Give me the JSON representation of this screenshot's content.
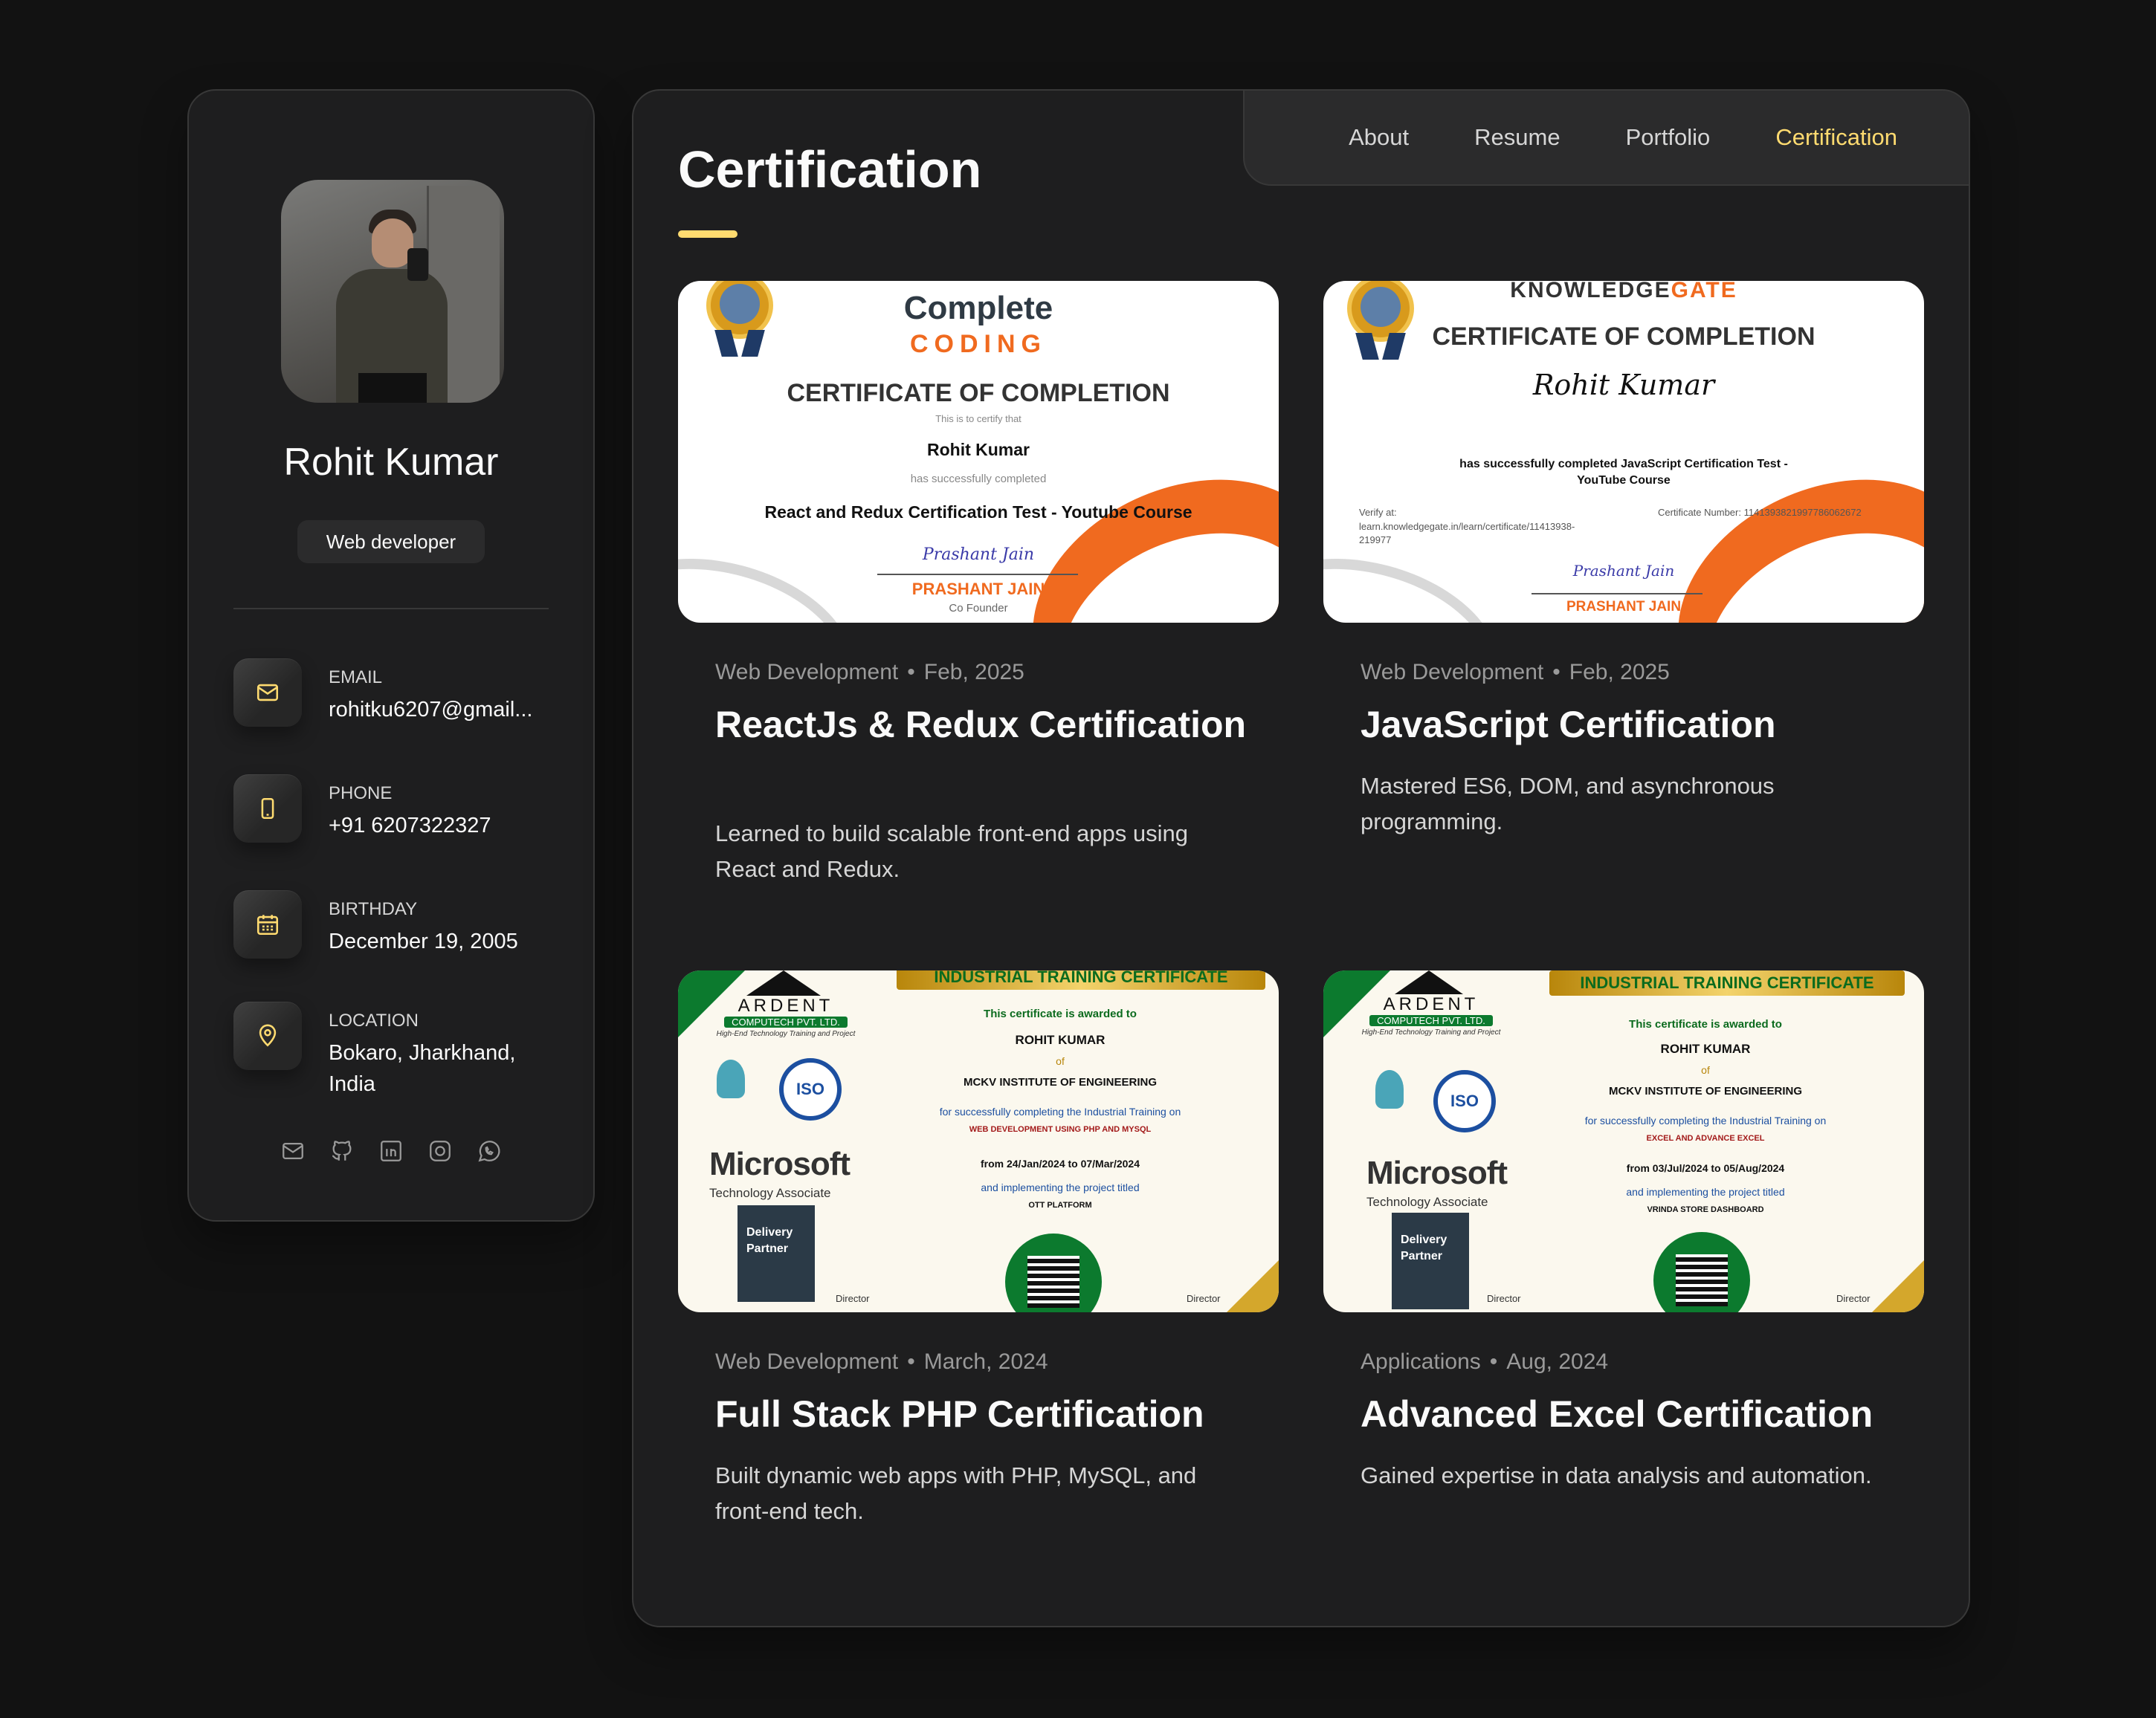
{
  "profile": {
    "name": "Rohit Kumar",
    "role": "Web developer",
    "contacts": [
      {
        "label": "Email",
        "value": "rohitku6207@gmail...",
        "icon": "mail-icon"
      },
      {
        "label": "Phone",
        "value": "+91 6207322327",
        "icon": "phone-icon"
      },
      {
        "label": "Birthday",
        "value": "December 19, 2005",
        "icon": "calendar-icon"
      },
      {
        "label": "Location",
        "value": "Bokaro, Jharkhand, India",
        "icon": "location-pin-icon"
      }
    ],
    "socials": [
      "mail-icon",
      "github-icon",
      "linkedin-icon",
      "instagram-icon",
      "whatsapp-icon"
    ]
  },
  "nav": {
    "items": [
      "About",
      "Resume",
      "Portfolio",
      "Certification"
    ],
    "active": "Certification"
  },
  "page": {
    "title": "Certification"
  },
  "colors": {
    "accent": "#ffdb70",
    "background": "#121212",
    "panel": "#1e1e1f",
    "certificate_orange": "#f06a1f",
    "certificate_green": "#0c7a2e"
  },
  "certificates": [
    {
      "category": "Web Development",
      "date": "Feb, 2025",
      "title": "ReactJs & Redux Certification",
      "description": "Learned to build scalable front-end apps using React and Redux.",
      "image": {
        "brand_top": "Complete",
        "brand_bottom": "CODING",
        "heading": "CERTIFICATE OF COMPLETION",
        "line1": "This is to certify that",
        "recipient": "Rohit Kumar",
        "line2": "has successfully completed",
        "course": "React and Redux Certification Test - Youtube Course",
        "signature": "Prashant Jain",
        "signer": "PRASHANT JAIN",
        "signer_title": "Co Founder"
      }
    },
    {
      "category": "Web Development",
      "date": "Feb, 2025",
      "title": "JavaScript Certification",
      "description": "Mastered ES6, DOM, and asynchronous programming.",
      "image": {
        "brand_a": "KNOWLEDGE",
        "brand_b": "GATE",
        "heading": "CERTIFICATE OF COMPLETION",
        "recipient": "Rohit Kumar",
        "course": "has successfully completed JavaScript Certification Test - YouTube Course",
        "verify_label": "Verify at:",
        "verify_url": "learn.knowledgegate.in/learn/certificate/11413938-219977",
        "cert_number": "Certificate Number: 114139382199778606267​2",
        "signature": "Prashant Jain",
        "signer": "PRASHANT JAIN"
      }
    },
    {
      "category": "Web Development",
      "date": "March, 2024",
      "title": "Full Stack PHP Certification",
      "description": "Built dynamic web apps with PHP, MySQL, and front-end tech.",
      "image": {
        "banner": "INDUSTRIAL TRAINING CERTIFICATE",
        "org": "ARDENT",
        "org_sub": "COMPUTECH PVT. LTD.",
        "org_tag": "High-End Technology Training and Project",
        "awarded": "This certificate is awarded to",
        "recipient": "ROHIT KUMAR",
        "of": "of",
        "institute": "MCKV INSTITUTE OF ENGINEERING",
        "completing": "for successfully completing the Industrial Training on",
        "topic": "WEB DEVELOPMENT USING PHP AND MYSQL",
        "period": "from 24/Jan/2024 to 07/Mar/2024",
        "implementing": "and implementing the project titled",
        "project": "OTT PLATFORM",
        "microsoft": "Microsoft",
        "ms_sub": "Technology Associate",
        "hpe_line1": "Delivery",
        "hpe_line2": "Partner",
        "iso": "ISO",
        "director": "Director"
      }
    },
    {
      "category": "Applications",
      "date": "Aug, 2024",
      "title": "Advanced Excel Certification",
      "description": "Gained expertise in data analysis and automation.",
      "image": {
        "banner": "INDUSTRIAL TRAINING CERTIFICATE",
        "org": "ARDENT",
        "org_sub": "COMPUTECH PVT. LTD.",
        "org_tag": "High-End Technology Training and Project",
        "awarded": "This certificate is awarded to",
        "recipient": "ROHIT KUMAR",
        "of": "of",
        "institute": "MCKV INSTITUTE OF ENGINEERING",
        "completing": "for successfully completing the Industrial Training on",
        "topic": "EXCEL AND ADVANCE EXCEL",
        "period": "from 03/Jul/2024 to 05/Aug/2024",
        "implementing": "and implementing the project titled",
        "project": "VRINDA STORE DASHBOARD",
        "microsoft": "Microsoft",
        "ms_sub": "Technology Associate",
        "hpe_line1": "Delivery",
        "hpe_line2": "Partner",
        "iso": "ISO",
        "director": "Director"
      }
    }
  ]
}
